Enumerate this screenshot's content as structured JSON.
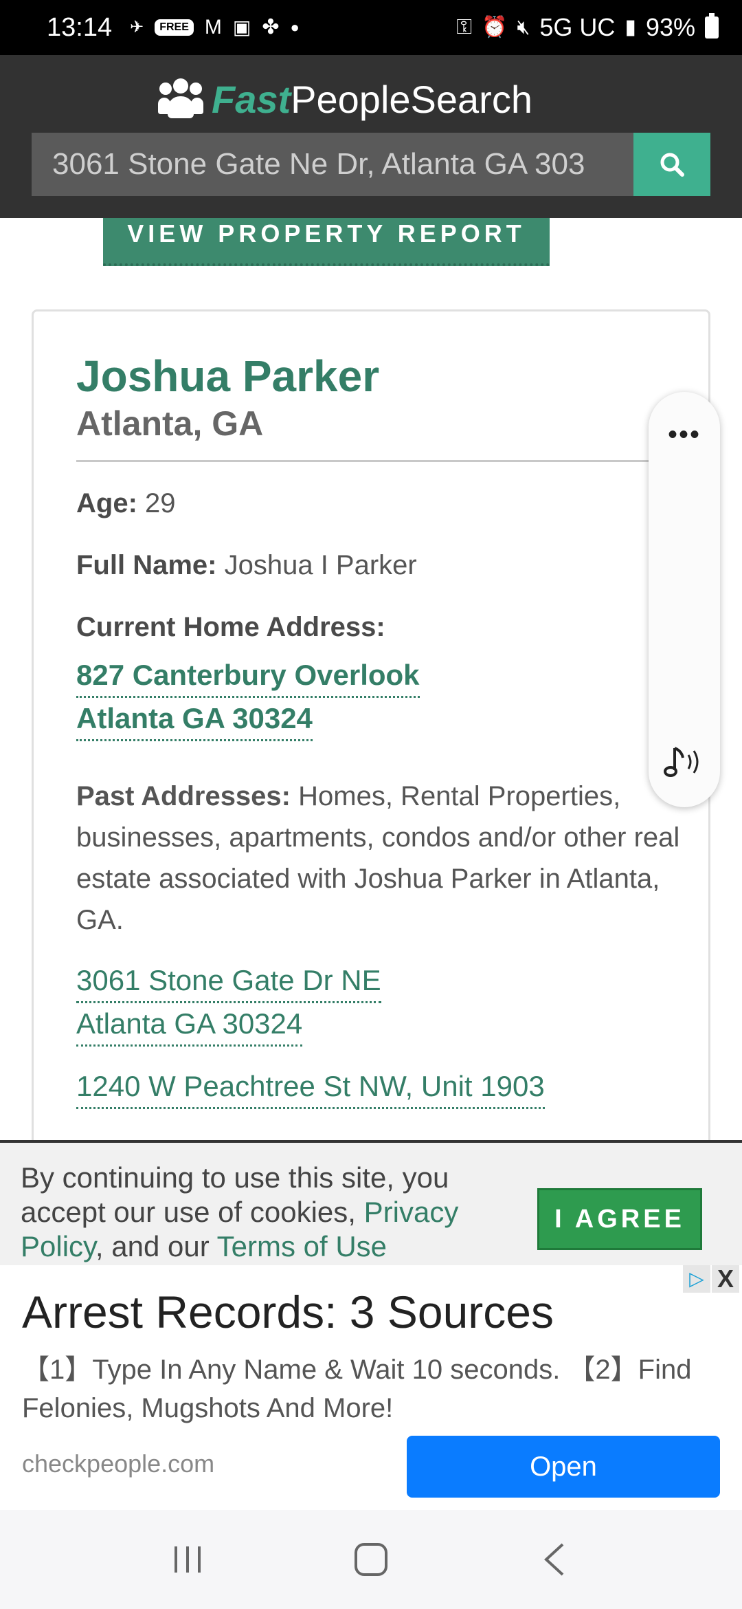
{
  "status_bar": {
    "time": "13:14",
    "network": "5G UC",
    "battery": "93%",
    "icons": [
      "fetch-icon",
      "free-badge-icon",
      "gmail-icon",
      "photo-icon",
      "pinwheel-icon",
      "dot-icon"
    ],
    "right_icons": [
      "key-icon",
      "alarm-icon",
      "mute-icon",
      "signal-icon",
      "battery-icon"
    ]
  },
  "header": {
    "logo_fast": "Fast",
    "logo_rest": "PeopleSearch",
    "search_value": "3061 Stone Gate Ne Dr, Atlanta GA 303",
    "search_icon": "search-icon",
    "accent": "#3fb08f",
    "bg": "#323232"
  },
  "property_button": "VIEW PROPERTY REPORT",
  "person": {
    "name": "Joshua Parker",
    "location": "Atlanta, GA",
    "age_label": "Age:",
    "age": "29",
    "full_name_label": "Full Name:",
    "full_name": "Joshua I Parker",
    "current_address_label": "Current Home Address:",
    "current_address_line1": "827 Canterbury Overlook",
    "current_address_line2": "Atlanta GA 30324",
    "past_label": "Past Addresses:",
    "past_desc": "Homes, Rental Properties, businesses, apartments, condos and/or other real estate associated with Joshua Parker in Atlanta, GA.",
    "past_addresses": [
      {
        "line1": "3061 Stone Gate Dr NE",
        "line2": "Atlanta GA 30324"
      },
      {
        "line1": "1240 W Peachtree St NW, Unit 1903",
        "line2": ""
      }
    ]
  },
  "floating_panel": {
    "dots_icon": "more-icon",
    "music_icon": "sound-icon"
  },
  "cookie": {
    "text_before": "By continuing to use this site, you accept our use of cookies, ",
    "privacy_link": "Privacy Policy",
    "text_mid": ", and our ",
    "terms_link": "Terms of Use",
    "agree": "I AGREE"
  },
  "ad": {
    "title": "Arrest Records: 3 Sources",
    "desc": "【1】Type In Any Name & Wait 10 seconds. 【2】Find Felonies, Mugshots And More!",
    "domain": "checkpeople.com",
    "open": "Open",
    "close": "X"
  },
  "nav": {
    "recents_icon": "recents-icon",
    "home_icon": "home-icon",
    "back_icon": "back-icon"
  }
}
